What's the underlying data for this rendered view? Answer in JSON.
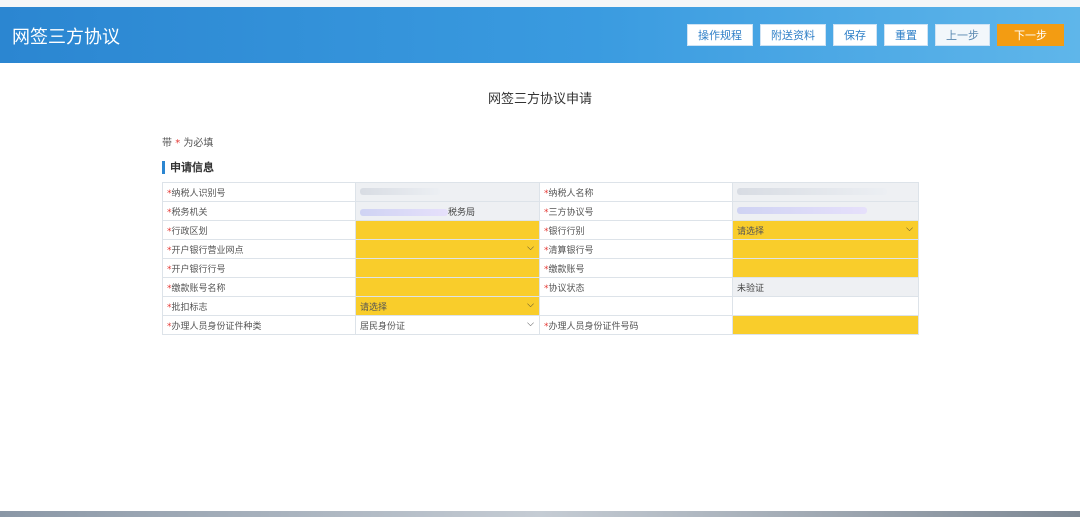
{
  "header": {
    "title": "网签三方协议",
    "buttons": [
      "操作规程",
      "附送资料",
      "保存",
      "重置",
      "上一步",
      "下一步"
    ]
  },
  "page_title": "网签三方协议申请",
  "required_note": {
    "prefix": "带",
    "star": "*",
    "suffix": "为必填"
  },
  "section": {
    "title": "申请信息"
  },
  "form": {
    "rows": [
      {
        "l1": "纳税人识别号",
        "v1": "",
        "l2": "纳税人名称",
        "v2": ""
      },
      {
        "l1": "税务机关",
        "v1": "税务局",
        "l2": "三方协议号",
        "v2": ""
      },
      {
        "l1": "行政区划",
        "v1": "",
        "l2": "银行行别",
        "v2": "请选择"
      },
      {
        "l1": "开户银行营业网点",
        "v1": "",
        "l2": "清算银行号",
        "v2": ""
      },
      {
        "l1": "开户银行行号",
        "v1": "",
        "l2": "缴款账号",
        "v2": ""
      },
      {
        "l1": "缴款账号名称",
        "v1": "",
        "l2": "协议状态",
        "v2": "未验证"
      },
      {
        "l1": "批扣标志",
        "v1": "请选择",
        "l2": "",
        "v2": ""
      },
      {
        "l1": "办理人员身份证件种类",
        "v1": "居民身份证",
        "l2": "办理人员身份证件号码",
        "v2": ""
      }
    ]
  },
  "colors": {
    "header_blue": "#2b86d1",
    "required_yellow": "#f9cd2b",
    "next_orange": "#f39c12",
    "star_red": "#e53935"
  },
  "icons": {
    "dropdown": "chevron-down-icon"
  }
}
